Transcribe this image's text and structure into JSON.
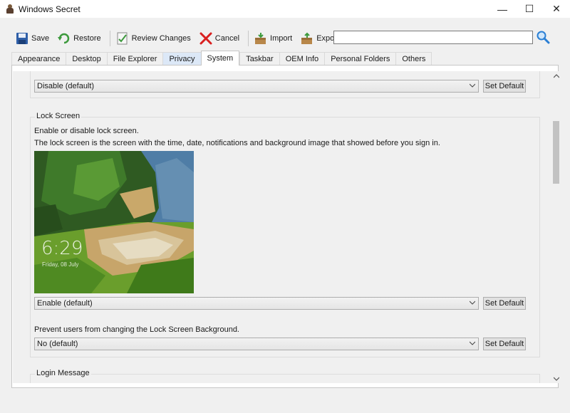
{
  "window": {
    "title": "Windows Secret",
    "minimize_glyph": "—",
    "maximize_glyph": "☐",
    "close_glyph": "✕"
  },
  "toolbar": {
    "save_label": "Save",
    "restore_label": "Restore",
    "review_label": "Review Changes",
    "cancel_label": "Cancel",
    "import_label": "Import",
    "export_label": "Export",
    "search_value": "",
    "search_placeholder": ""
  },
  "tabs": [
    {
      "label": "Appearance"
    },
    {
      "label": "Desktop"
    },
    {
      "label": "File Explorer"
    },
    {
      "label": "Privacy"
    },
    {
      "label": "System"
    },
    {
      "label": "Taskbar"
    },
    {
      "label": "OEM Info"
    },
    {
      "label": "Personal Folders"
    },
    {
      "label": "Others"
    }
  ],
  "active_tab": "System",
  "sections": {
    "top": {
      "select_value": "Disable (default)",
      "button_label": "Set Default"
    },
    "lock_screen": {
      "title": "Lock Screen",
      "description1": "Enable or disable lock screen.",
      "description2": "The lock screen is the screen with the time, date, notifications and background image that showed before you sign in.",
      "preview_time": "6:29",
      "preview_date": "Friday, 08 July",
      "select_value": "Enable (default)",
      "button_label": "Set Default",
      "bg_label": "Prevent users from changing the Lock Screen Background.",
      "bg_select_value": "No (default)",
      "bg_button_label": "Set Default"
    },
    "login_message": {
      "title": "Login Message"
    }
  },
  "colors": {
    "accent_blue": "#1f5ab0",
    "active_tab_bg": "#ffffff",
    "hover_tab_bg": "#dce8f7"
  }
}
